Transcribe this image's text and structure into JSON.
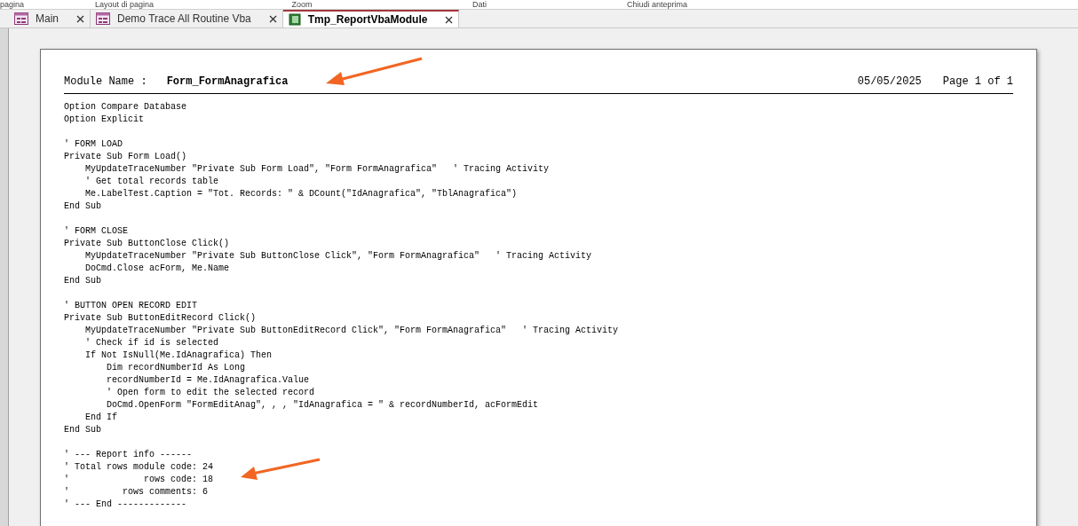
{
  "ribbon": [
    "pagina",
    "Layout di pagina",
    "Zoom",
    "Dati",
    "Chiudi anteprima"
  ],
  "tabs": [
    {
      "label": "Main",
      "selected": false,
      "kind": "form"
    },
    {
      "label": "Demo Trace All Routine Vba",
      "selected": false,
      "kind": "form"
    },
    {
      "label": "Tmp_ReportVbaModule",
      "selected": true,
      "kind": "report"
    }
  ],
  "report": {
    "module_label": "Module Name :",
    "module_name": "Form_FormAnagrafica",
    "date": "05/05/2025",
    "page": "Page 1 of 1",
    "blocks": [
      [
        "Option Compare Database",
        "Option Explicit"
      ],
      [
        "' FORM LOAD",
        "Private Sub Form Load()",
        "    MyUpdateTraceNumber \"Private Sub Form Load\", \"Form FormAnagrafica\"   ' Tracing Activity",
        "    ' Get total records table",
        "    Me.LabelTest.Caption = \"Tot. Records: \" & DCount(\"IdAnagrafica\", \"TblAnagrafica\")",
        "End Sub"
      ],
      [
        "' FORM CLOSE",
        "Private Sub ButtonClose Click()",
        "    MyUpdateTraceNumber \"Private Sub ButtonClose Click\", \"Form FormAnagrafica\"   ' Tracing Activity",
        "    DoCmd.Close acForm, Me.Name",
        "End Sub"
      ],
      [
        "' BUTTON OPEN RECORD EDIT",
        "Private Sub ButtonEditRecord Click()",
        "    MyUpdateTraceNumber \"Private Sub ButtonEditRecord Click\", \"Form FormAnagrafica\"   ' Tracing Activity",
        "    ' Check if id is selected",
        "    If Not IsNull(Me.IdAnagrafica) Then",
        "        Dim recordNumberId As Long",
        "        recordNumberId = Me.IdAnagrafica.Value",
        "        ' Open form to edit the selected record",
        "        DoCmd.OpenForm \"FormEditAnag\", , , \"IdAnagrafica = \" & recordNumberId, acFormEdit",
        "    End If",
        "End Sub"
      ],
      [
        "' --- Report info ------",
        "' Total rows module code: 24",
        "'              rows code: 18",
        "'          rows comments: 6",
        "' --- End -------------"
      ]
    ]
  }
}
